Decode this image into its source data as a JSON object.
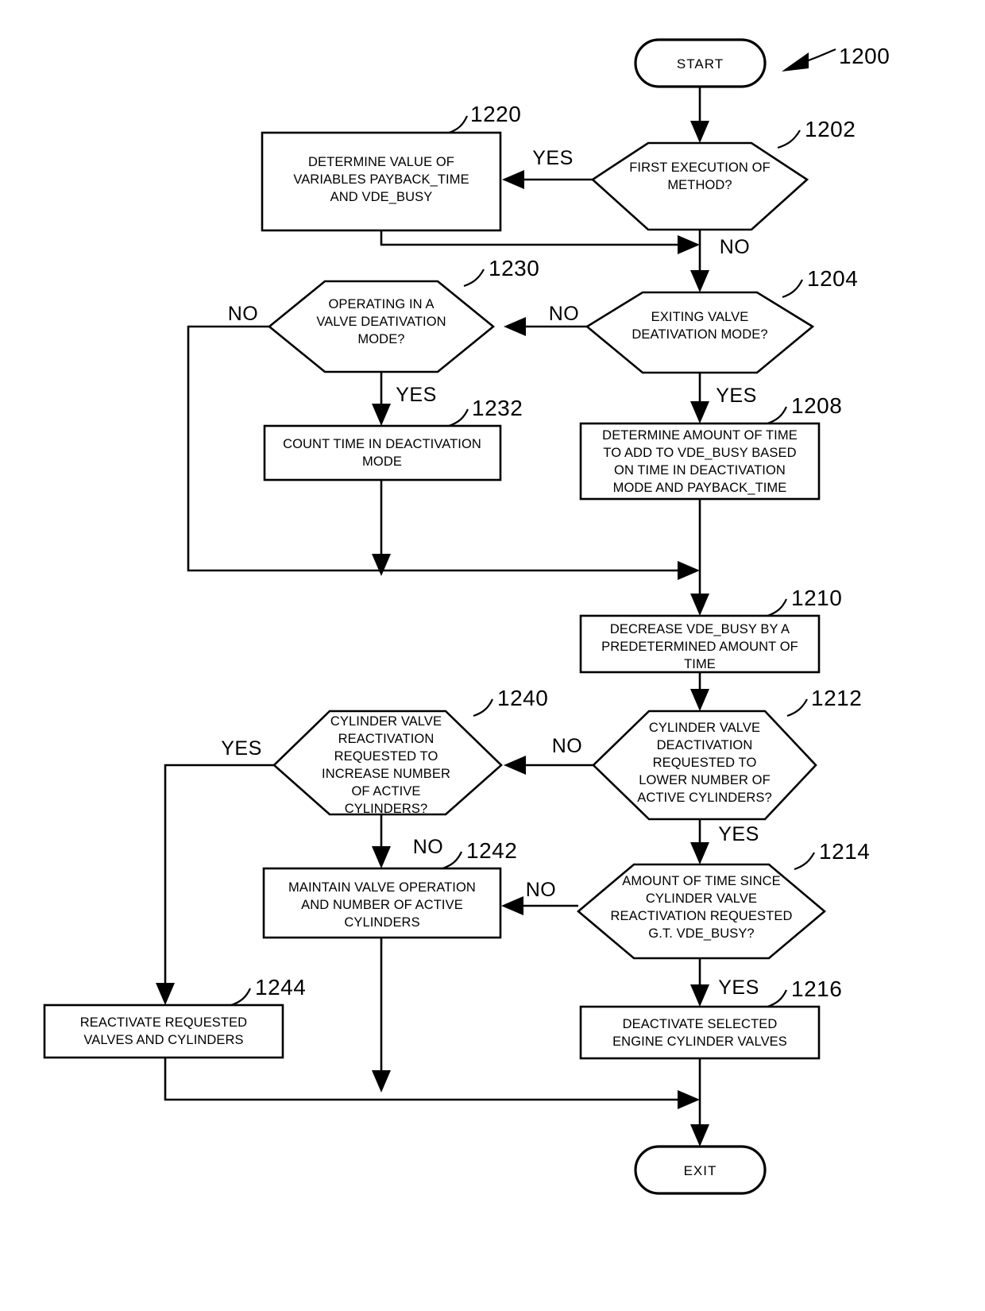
{
  "figure": {
    "reference_number": "1200",
    "type": "flowchart"
  },
  "terminals": {
    "start": "START",
    "exit": "EXIT"
  },
  "nodes": [
    {
      "id": "1202",
      "ref": "1202",
      "shape": "decision",
      "lines": [
        "FIRST EXECUTION OF",
        "METHOD?"
      ]
    },
    {
      "id": "1220",
      "ref": "1220",
      "shape": "process",
      "lines": [
        "DETERMINE VALUE OF",
        "VARIABLES PAYBACK_TIME",
        "AND  VDE_BUSY"
      ]
    },
    {
      "id": "1204",
      "ref": "1204",
      "shape": "decision",
      "lines": [
        "EXITING VALVE",
        "DEATIVATION MODE?"
      ]
    },
    {
      "id": "1230",
      "ref": "1230",
      "shape": "decision",
      "lines": [
        "OPERATING IN A",
        "VALVE DEATIVATION",
        "MODE?"
      ]
    },
    {
      "id": "1232",
      "ref": "1232",
      "shape": "process",
      "lines": [
        "COUNT TIME IN DEACTIVATION",
        "MODE"
      ]
    },
    {
      "id": "1208",
      "ref": "1208",
      "shape": "process",
      "lines": [
        "DETERMINE AMOUNT OF TIME",
        "TO ADD TO VDE_BUSY BASED",
        "ON TIME IN DEACTIVATION",
        "MODE AND PAYBACK_TIME"
      ]
    },
    {
      "id": "1210",
      "ref": "1210",
      "shape": "process",
      "lines": [
        "DECREASE VDE_BUSY BY A",
        "PREDETERMINED AMOUNT OF",
        "TIME"
      ]
    },
    {
      "id": "1212",
      "ref": "1212",
      "shape": "decision",
      "lines": [
        "CYLINDER VALVE",
        "DEACTIVATION",
        "REQUESTED TO",
        "LOWER NUMBER OF",
        "ACTIVE CYLINDERS?"
      ]
    },
    {
      "id": "1240",
      "ref": "1240",
      "shape": "decision",
      "lines": [
        "CYLINDER VALVE",
        "REACTIVATION",
        "REQUESTED TO",
        "INCREASE NUMBER",
        "OF ACTIVE",
        "CYLINDERS?"
      ]
    },
    {
      "id": "1214",
      "ref": "1214",
      "shape": "decision",
      "lines": [
        "AMOUNT OF TIME SINCE",
        "CYLINDER VALVE",
        "REACTIVATION REQUESTED",
        "G.T. VDE_BUSY?"
      ]
    },
    {
      "id": "1242",
      "ref": "1242",
      "shape": "process",
      "lines": [
        "MAINTAIN VALVE OPERATION",
        "AND NUMBER OF ACTIVE",
        "CYLINDERS"
      ]
    },
    {
      "id": "1216",
      "ref": "1216",
      "shape": "process",
      "lines": [
        "DEACTIVATE SELECTED",
        "ENGINE CYLINDER VALVES"
      ]
    },
    {
      "id": "1244",
      "ref": "1244",
      "shape": "process",
      "lines": [
        "REACTIVATE REQUESTED",
        "VALVES AND CYLINDERS"
      ]
    }
  ],
  "branch_labels": {
    "n1202_yes": "YES",
    "n1202_no": "NO",
    "n1204_no": "NO",
    "n1204_yes": "YES",
    "n1230_no": "NO",
    "n1230_yes": "YES",
    "n1212_no": "NO",
    "n1212_yes": "YES",
    "n1240_yes": "YES",
    "n1240_no": "NO",
    "n1214_no": "NO",
    "n1214_yes": "YES"
  },
  "colors": {
    "stroke": "#000000",
    "fill": "#ffffff",
    "background": "#ffffff"
  }
}
